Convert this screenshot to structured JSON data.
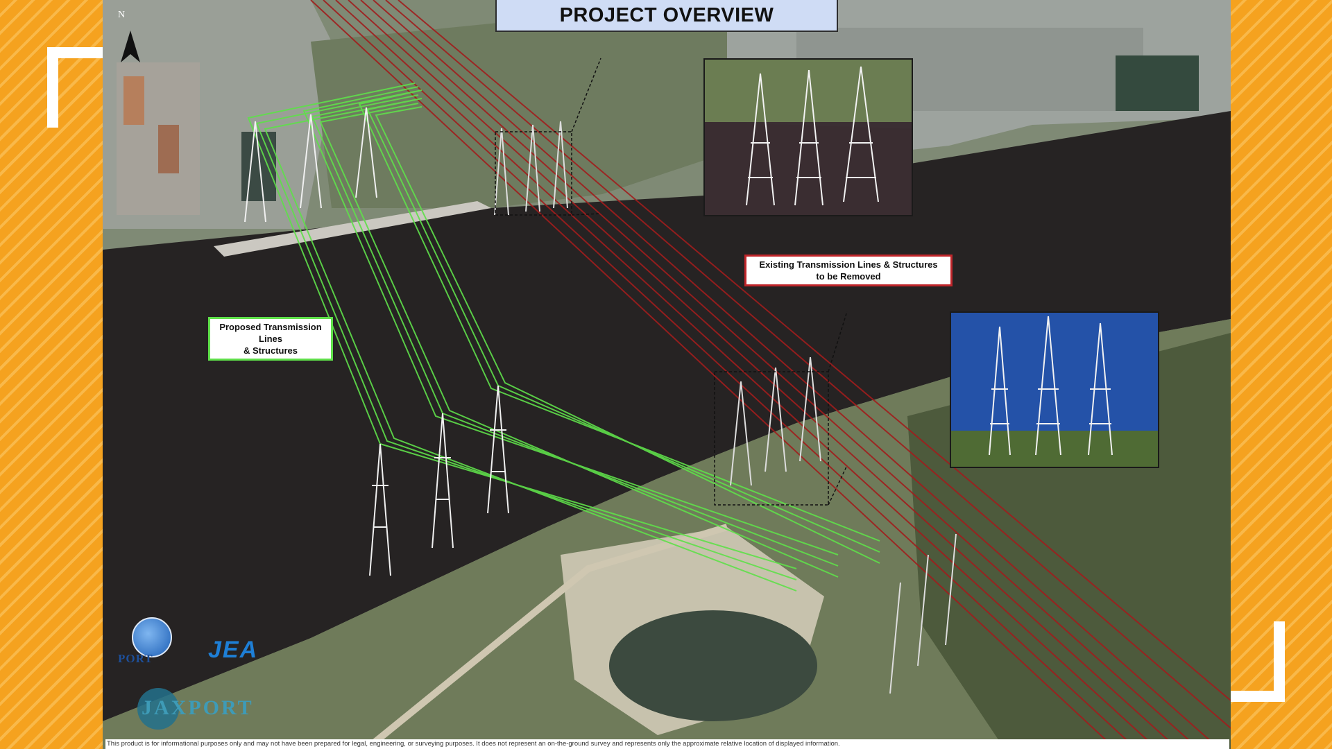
{
  "title": "PROJECT OVERVIEW",
  "north_label": "N",
  "labels": {
    "proposed": "Proposed Transmission Lines\n& Structures",
    "existing": "Existing Transmission Lines & Structures\nto be Removed"
  },
  "logos": {
    "port_text": "PORT",
    "jea": "JEA",
    "jaxport": "JAXPORT"
  },
  "disclaimer": "This product is for informational purposes only and may not have been prepared for legal, engineering, or surveying purposes. It does not represent an on-the-ground survey and represents only the approximate relative location of displayed information.",
  "colors": {
    "proposed_line": "#5fe04a",
    "existing_line": "#a11d1d",
    "river": "#262323",
    "frame_orange": "#f5a21f"
  },
  "icons": [
    "north-arrow-icon",
    "transmission-tower-icon"
  ]
}
